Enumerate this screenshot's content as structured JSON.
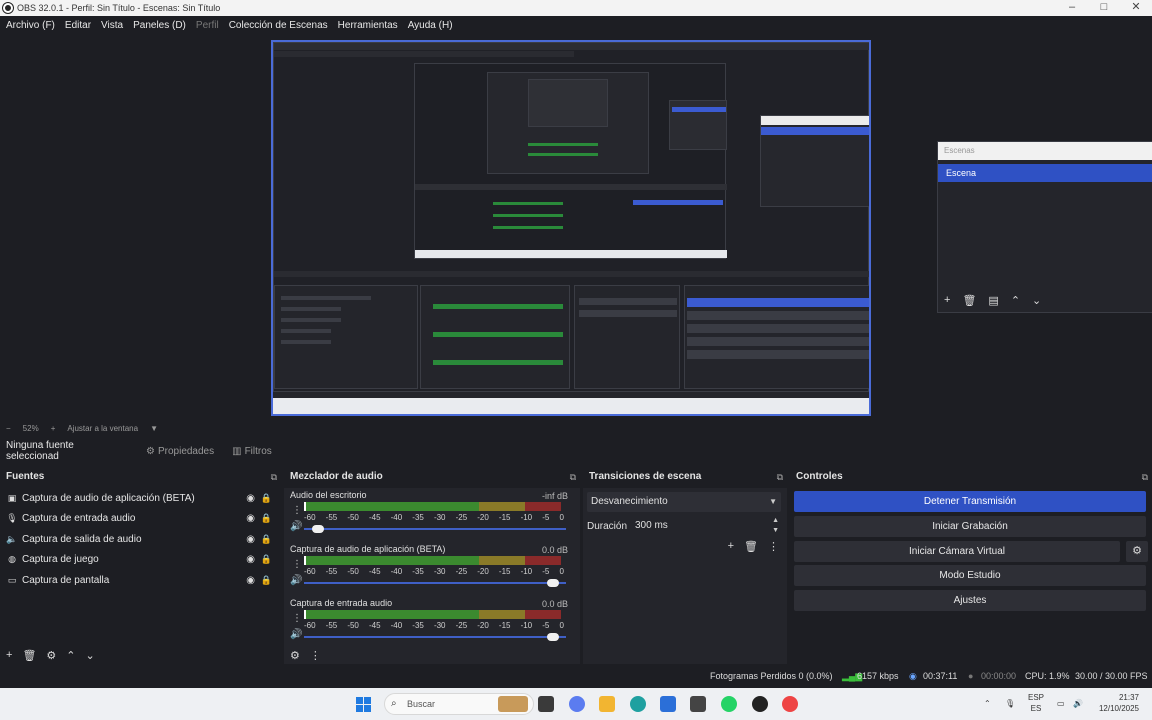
{
  "window": {
    "title": "OBS 32.0.1 - Perfil: Sin Título - Escenas: Sin Título",
    "minimize": "–",
    "maximize": "□",
    "close": "✕"
  },
  "menu": {
    "items": [
      "Archivo (F)",
      "Editar",
      "Vista",
      "Paneles (D)",
      "Perfil",
      "Colección de Escenas",
      "Herramientas",
      "Ayuda (H)"
    ]
  },
  "scenes_panel": {
    "title": "Escenas",
    "selected_scene": "Escena"
  },
  "zoom_bar": {
    "minus": "−",
    "zoom": "52%",
    "plus": "+",
    "fit": "Ajustar a la ventana",
    "dropdown": "▼"
  },
  "source_toolbar": {
    "no_source": "Ninguna fuente seleccionad",
    "properties": "Propiedades",
    "filters": "Filtros"
  },
  "sources": {
    "title": "Fuentes",
    "items": [
      {
        "label": "Captura de audio de aplicación (BETA)",
        "icon": "app-audio-icon"
      },
      {
        "label": "Captura de entrada audio",
        "icon": "microphone-icon"
      },
      {
        "label": "Captura de salida de audio",
        "icon": "speaker-icon"
      },
      {
        "label": "Captura de juego",
        "icon": "gamepad-icon"
      },
      {
        "label": "Captura de pantalla",
        "icon": "monitor-icon"
      }
    ]
  },
  "mixer": {
    "title": "Mezclador de audio",
    "scale": [
      "-60",
      "-55",
      "-50",
      "-45",
      "-40",
      "-35",
      "-30",
      "-25",
      "-20",
      "-15",
      "-10",
      "-5",
      "0"
    ],
    "channels": [
      {
        "name": "Audio del escritorio",
        "db": "-inf dB",
        "volume": 0.03,
        "level": 0.0
      },
      {
        "name": "Captura de audio de aplicación (BETA)",
        "db": "0.0 dB",
        "volume": 0.97,
        "level": 0.0
      },
      {
        "name": "Captura de entrada audio",
        "db": "0.0 dB",
        "volume": 0.97,
        "level": 0.0
      }
    ]
  },
  "transitions": {
    "title": "Transiciones de escena",
    "selected": "Desvanecimiento",
    "duration_label": "Duración",
    "duration_value": "300 ms"
  },
  "controls": {
    "title": "Controles",
    "stop_stream": "Detener Transmisión",
    "start_recording": "Iniciar Grabación",
    "start_virtual_cam": "Iniciar Cámara Virtual",
    "studio_mode": "Modo Estudio",
    "settings": "Ajustes"
  },
  "status": {
    "dropped_frames": "Fotogramas Perdidos 0 (0.0%)",
    "bitrate": "6157 kbps",
    "stream_time": "00:37:11",
    "record_time": "00:00:00",
    "cpu": "CPU: 1.9%",
    "fps": "30.00 / 30.00 FPS"
  },
  "taskbar": {
    "search_placeholder": "Buscar",
    "lang_top": "ESP",
    "lang_bottom": "ES",
    "time": "21:37",
    "date": "12/10/2025"
  },
  "colors": {
    "accent": "#2f51c4",
    "background": "#1d1e23",
    "panel": "#24252b",
    "meter_green": "#3b8a2f",
    "meter_yellow": "#8a7a28",
    "meter_red": "#8a2a2a"
  }
}
